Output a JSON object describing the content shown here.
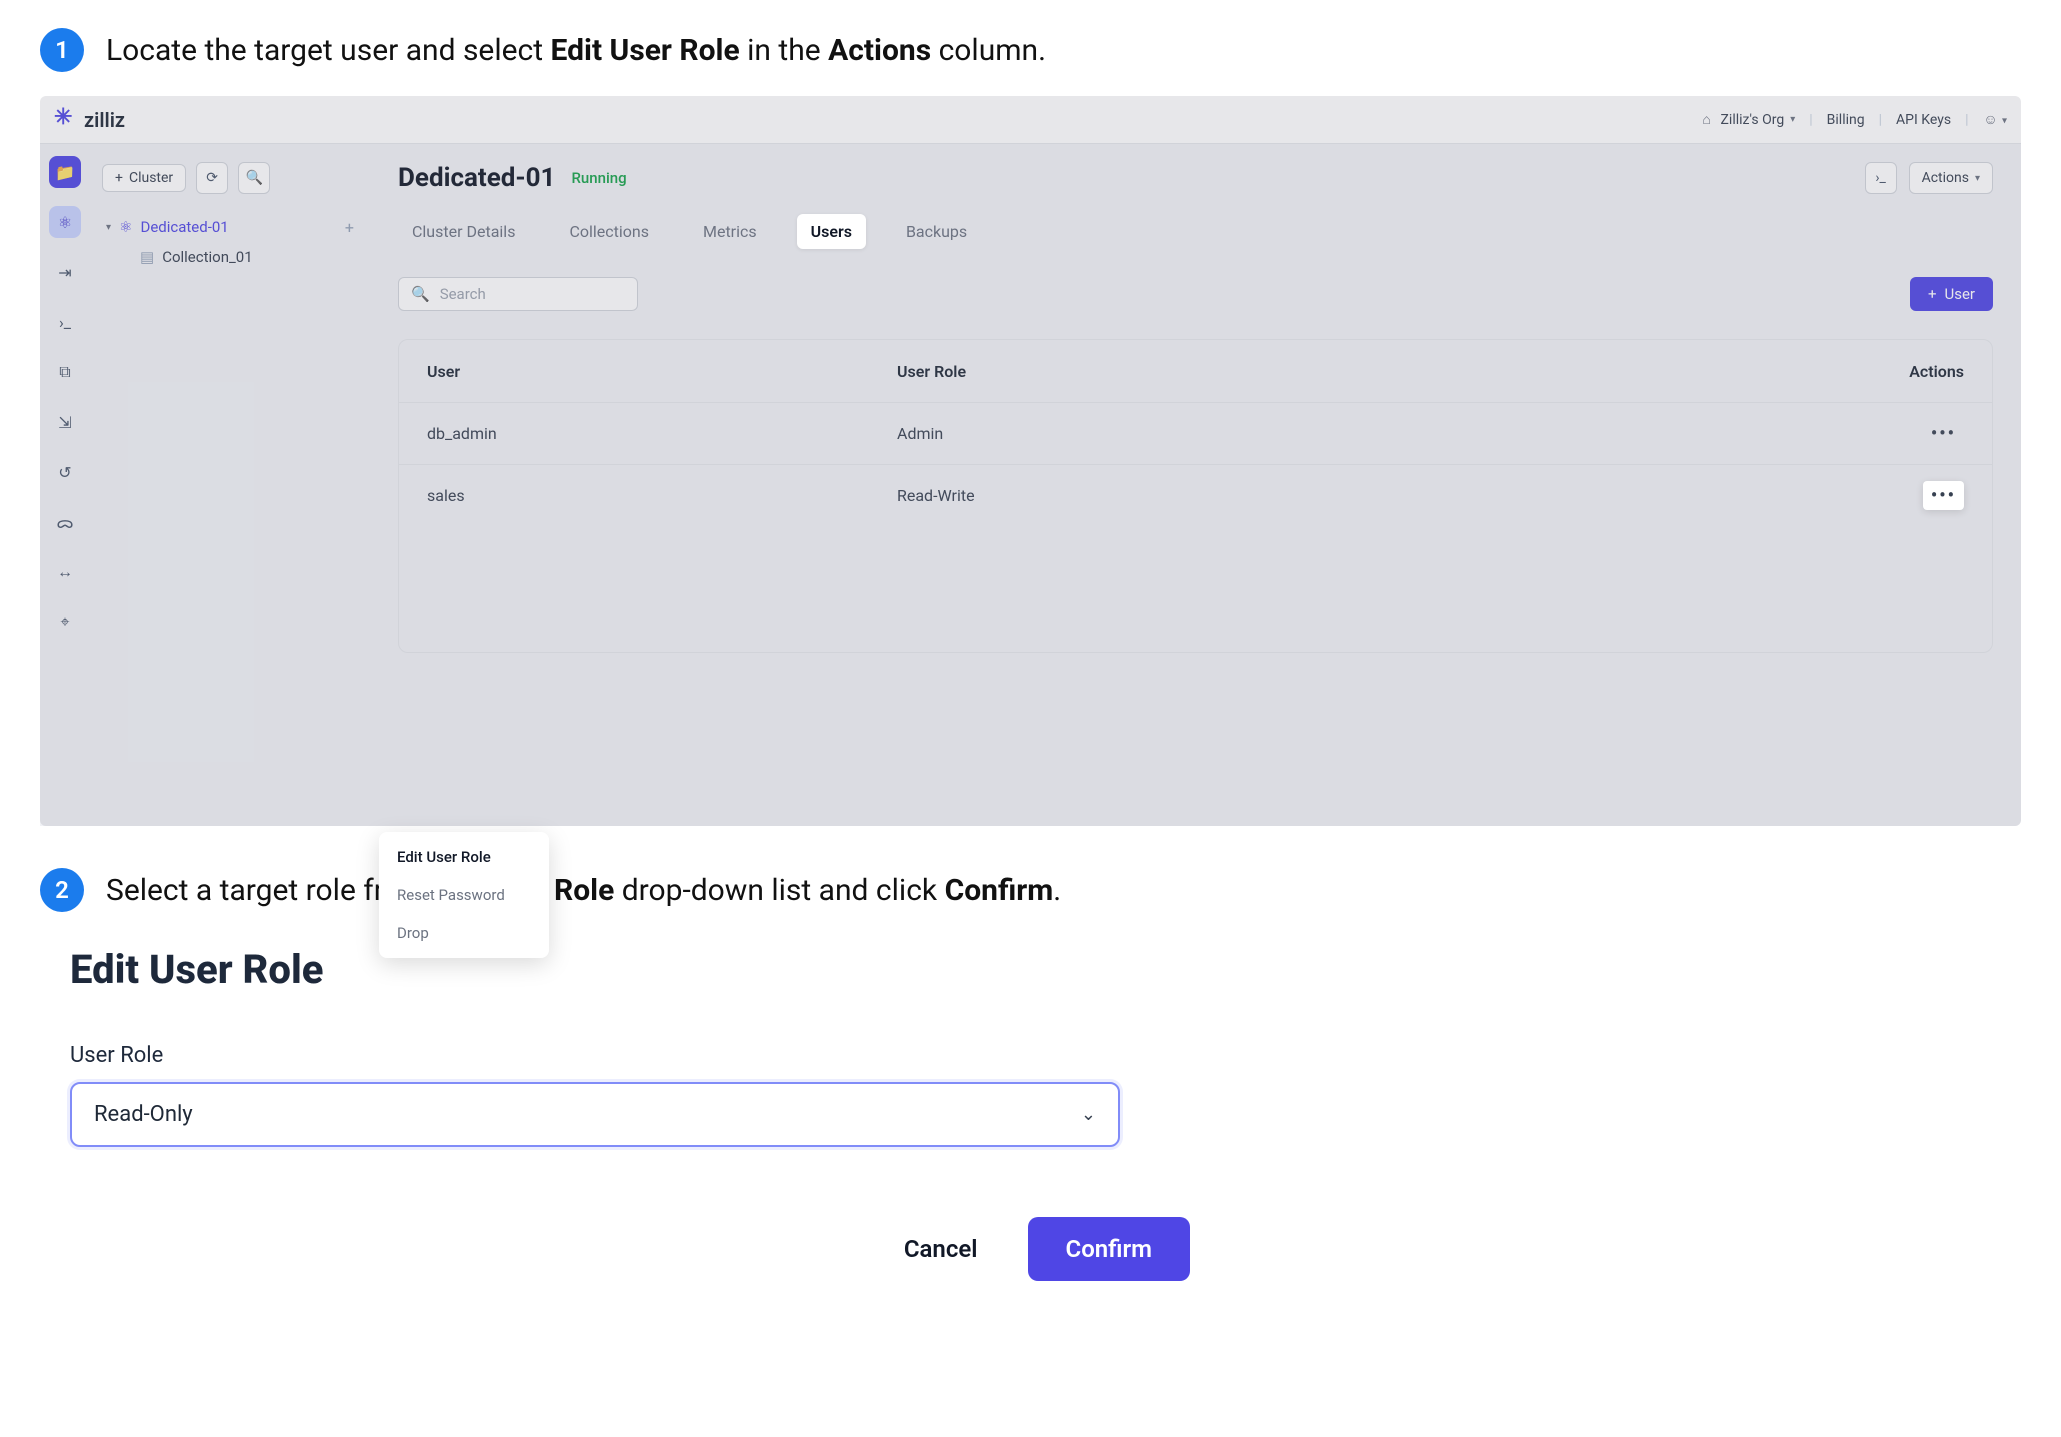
{
  "steps": {
    "one": {
      "num": "1",
      "text_a": "Locate the target user and select ",
      "b1": "Edit User Role",
      "text_b": " in the ",
      "b2": "Actions",
      "text_c": " column."
    },
    "two": {
      "num": "2",
      "text_a": "Select a target role from the ",
      "b1": "User Role",
      "text_b": " drop-down list and click ",
      "b2": "Confirm",
      "text_c": "."
    }
  },
  "topbar": {
    "brand": "zilliz",
    "org_label": "Zilliz's Org",
    "billing": "Billing",
    "api_keys": "API Keys"
  },
  "sidebar": {
    "add_cluster": "Cluster",
    "tree": {
      "cluster": "Dedicated-01",
      "collection": "Collection_01"
    }
  },
  "main": {
    "title": "Dedicated-01",
    "status": "Running",
    "actions_btn": "Actions",
    "tabs": [
      "Cluster Details",
      "Collections",
      "Metrics",
      "Users",
      "Backups"
    ],
    "active_tab_index": 3,
    "search_placeholder": "Search",
    "add_user_btn": "User",
    "columns": {
      "user": "User",
      "role": "User Role",
      "actions": "Actions"
    },
    "rows": [
      {
        "user": "db_admin",
        "role": "Admin"
      },
      {
        "user": "sales",
        "role": "Read-Write"
      }
    ],
    "menu": {
      "edit": "Edit User Role",
      "reset": "Reset Password",
      "drop": "Drop"
    }
  },
  "dialog": {
    "title": "Edit User Role",
    "field_label": "User Role",
    "selected": "Read-Only",
    "cancel": "Cancel",
    "confirm": "Confirm"
  }
}
